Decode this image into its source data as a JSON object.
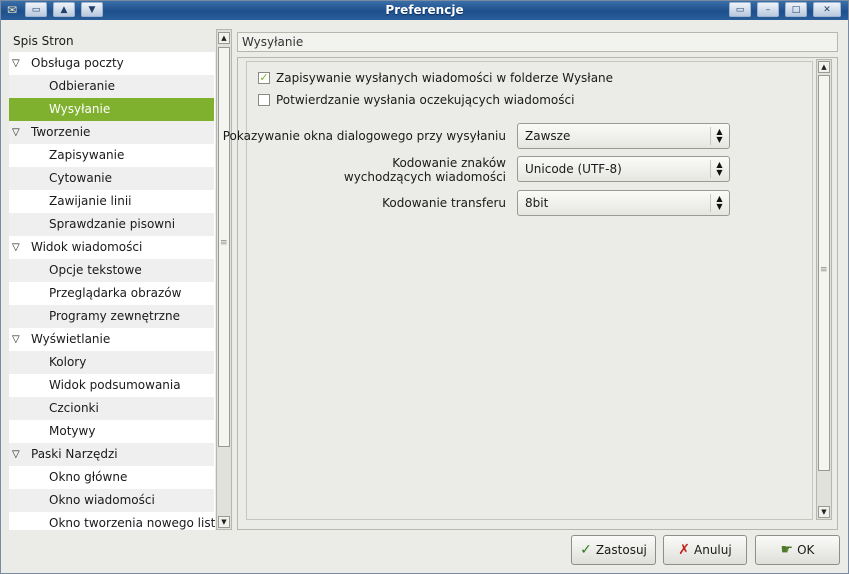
{
  "window": {
    "title": "Preferencje"
  },
  "left": {
    "header": "Spis Stron",
    "rows": [
      {
        "label": "Obsługa poczty",
        "level": 0
      },
      {
        "label": "Odbieranie",
        "level": 1
      },
      {
        "label": "Wysyłanie",
        "level": 1,
        "selected": true
      },
      {
        "label": "Tworzenie",
        "level": 0
      },
      {
        "label": "Zapisywanie",
        "level": 1
      },
      {
        "label": "Cytowanie",
        "level": 1
      },
      {
        "label": "Zawijanie linii",
        "level": 1
      },
      {
        "label": "Sprawdzanie pisowni",
        "level": 1
      },
      {
        "label": "Widok wiadomości",
        "level": 0
      },
      {
        "label": "Opcje tekstowe",
        "level": 1
      },
      {
        "label": "Przeglądarka obrazów",
        "level": 1
      },
      {
        "label": "Programy zewnętrzne",
        "level": 1
      },
      {
        "label": "Wyświetlanie",
        "level": 0
      },
      {
        "label": "Kolory",
        "level": 1
      },
      {
        "label": "Widok podsumowania",
        "level": 1
      },
      {
        "label": "Czcionki",
        "level": 1
      },
      {
        "label": "Motywy",
        "level": 1
      },
      {
        "label": "Paski Narzędzi",
        "level": 0
      },
      {
        "label": "Okno główne",
        "level": 1
      },
      {
        "label": "Okno wiadomości",
        "level": 1
      },
      {
        "label": "Okno tworzenia nowego listu",
        "level": 1
      }
    ]
  },
  "right": {
    "header": "Wysyłanie",
    "checkbox_save_sent": {
      "label": "Zapisywanie wysłanych wiadomości w folderze Wysłane",
      "checked": true
    },
    "checkbox_confirm_queued": {
      "label": "Potwierdzanie wysłania oczekujących wiadomości",
      "checked": false
    },
    "dialog_label": "Pokazywanie okna dialogowego przy wysyłaniu",
    "dialog_value": "Zawsze",
    "charset_label_1": "Kodowanie znaków",
    "charset_label_2": "wychodzących wiadomości",
    "charset_value": "Unicode (UTF-8)",
    "transfer_label": "Kodowanie transferu",
    "transfer_value": "8bit"
  },
  "buttons": {
    "apply": "Zastosuj",
    "cancel": "Anuluj",
    "ok": "OK"
  },
  "colors": {
    "selection": "#7fb12e",
    "titlebar": "#1d4f8c"
  }
}
